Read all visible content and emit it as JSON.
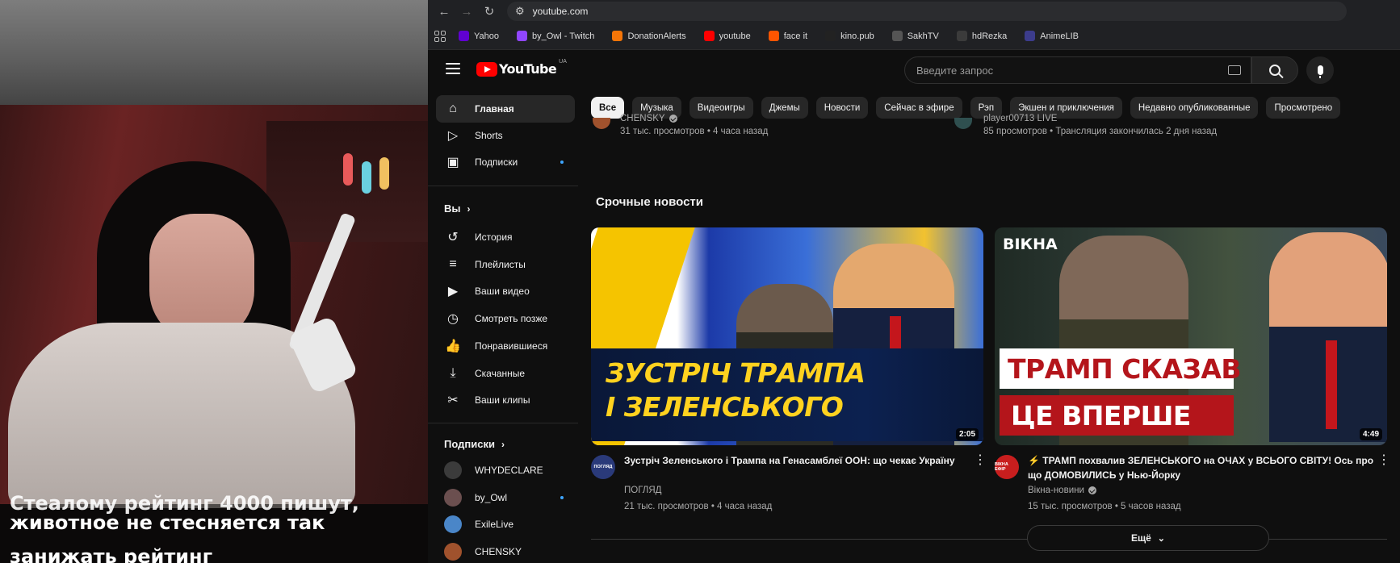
{
  "webcam": {
    "caption_lines": [
      "Стеалому рейтинг 4000 пишут,",
      "животное не стесняется так",
      "занижать рейтинг"
    ]
  },
  "browser": {
    "url": "youtube.com",
    "bookmarks": [
      {
        "label": "Yahoo",
        "icon": "yahoo-icon",
        "color": "#6001d2"
      },
      {
        "label": "by_Owl - Twitch",
        "icon": "twitch-icon",
        "color": "#9146ff"
      },
      {
        "label": "DonationAlerts",
        "icon": "donationalerts-icon",
        "color": "#f57507"
      },
      {
        "label": "youtube",
        "icon": "youtube-icon",
        "color": "#ff0000"
      },
      {
        "label": "face it",
        "icon": "faceit-icon",
        "color": "#ff5500"
      },
      {
        "label": "kino.pub",
        "icon": "kinopub-icon",
        "color": "#222222"
      },
      {
        "label": "SakhTV",
        "icon": "sakhtv-icon",
        "color": "#555555"
      },
      {
        "label": "hdRezka",
        "icon": "hdrezka-icon",
        "color": "#3b3b3b"
      },
      {
        "label": "AnimeLIB",
        "icon": "animelib-icon",
        "color": "#3c3c8c"
      }
    ]
  },
  "youtube": {
    "logo_text": "YouTube",
    "country_code": "UA",
    "search_placeholder": "Введите запрос",
    "sidebar": {
      "main": [
        {
          "label": "Главная",
          "icon": "home-icon",
          "active": true
        },
        {
          "label": "Shorts",
          "icon": "shorts-icon"
        },
        {
          "label": "Подписки",
          "icon": "subscriptions-icon",
          "dot": true
        }
      ],
      "you_header": "Вы",
      "you": [
        {
          "label": "История",
          "icon": "history-icon"
        },
        {
          "label": "Плейлисты",
          "icon": "playlists-icon"
        },
        {
          "label": "Ваши видео",
          "icon": "your-videos-icon"
        },
        {
          "label": "Смотреть позже",
          "icon": "watch-later-icon"
        },
        {
          "label": "Понравившиеся",
          "icon": "liked-icon"
        },
        {
          "label": "Скачанные",
          "icon": "downloads-icon"
        },
        {
          "label": "Ваши клипы",
          "icon": "clips-icon"
        }
      ],
      "subs_header": "Подписки",
      "subscriptions": [
        {
          "label": "WHYDECLARE",
          "color": "#3b3b3b",
          "dot": false
        },
        {
          "label": "by_Owl",
          "color": "#6b4f4f",
          "dot": true
        },
        {
          "label": "ExileLive",
          "color": "#4a86c8",
          "dot": false
        },
        {
          "label": "CHENSKY",
          "color": "#a0522d",
          "dot": false
        }
      ]
    },
    "chips": [
      "Все",
      "Музыка",
      "Видеоигры",
      "Джемы",
      "Новости",
      "Сейчас в эфире",
      "Рэп",
      "Экшен и приключения",
      "Недавно опубликованные",
      "Просмотрено"
    ],
    "top_row": [
      {
        "channel": "CHENSKY",
        "verified": true,
        "meta": "31 тыс. просмотров • 4 часа назад"
      },
      {
        "channel": "player00713 LIVE",
        "verified": false,
        "meta": "85 просмотров • Трансляция закончилась 2 дня назад"
      }
    ],
    "section_title": "Срочные новости",
    "videos": [
      {
        "thumb_text": [
          "ЗУСТРІЧ ТРАМПА",
          "І ЗЕЛЕНСЬКОГО"
        ],
        "duration": "2:05",
        "avatar_text": "ПОГЛЯД",
        "title": "Зустріч Зеленського і Трампа на Генасамблеї ООН: що чекає Україну",
        "channel": "ПОГЛЯД",
        "verified": false,
        "meta": "21 тыс. просмотров • 4 часа назад"
      },
      {
        "thumb_brand": "ВІКНА",
        "thumb_text": [
          "ТРАМП СКАЗАВ",
          "ЦЕ ВПЕРШЕ"
        ],
        "duration": "4:49",
        "avatar_text": "ВІКНА ЕФІР",
        "title": "⚡ ТРАМП похвалив ЗЕЛЕНСЬКОГО на ОЧАХ у ВСЬОГО СВІТУ! Ось про що ДОМОВИЛИСЬ у Нью-Йорку",
        "channel": "Вікна-новини",
        "verified": true,
        "meta": "15 тыс. просмотров • 5 часов назад"
      }
    ],
    "more_label": "Ещё"
  }
}
